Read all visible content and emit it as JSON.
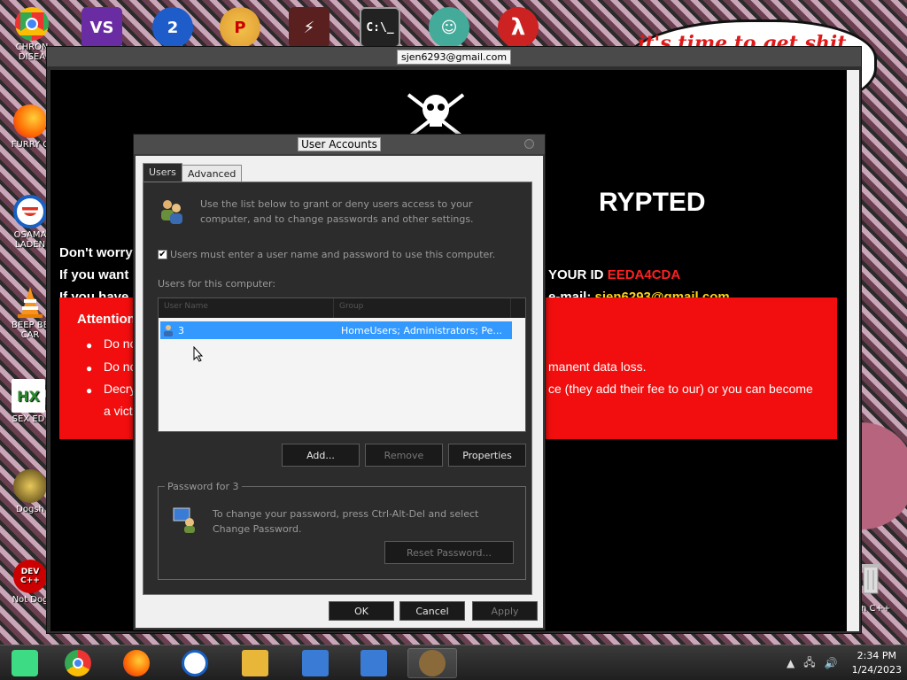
{
  "desktop": {
    "icons": [
      {
        "label": "CHRON DISEA",
        "glyph": "",
        "color": "#e33"
      },
      {
        "label": "FURRY C",
        "glyph": "",
        "color": "#f60"
      },
      {
        "label": "OSAMA LADEN",
        "glyph": "",
        "color": "#1760c4"
      },
      {
        "label": "BEEP BE CAR",
        "glyph": "",
        "color": "#f7931e"
      },
      {
        "label": "SEX ED",
        "glyph": "HX",
        "color": "#4a4"
      },
      {
        "label": "Dogsh",
        "glyph": "",
        "color": "#aa8a2a"
      },
      {
        "label": "Not Dog",
        "glyph": "DEV C++",
        "color": "#c00"
      }
    ],
    "top_icons": [
      {
        "name": "visual-studio-icon",
        "glyph": "VS",
        "color": "#6a2ca3"
      },
      {
        "name": "vcs-2-icon",
        "glyph": "2",
        "color": "#1d5cc9"
      },
      {
        "name": "p-app-icon",
        "glyph": "P",
        "color": "#d93"
      },
      {
        "name": "thunder-game-icon",
        "glyph": "⚡",
        "color": "#b33"
      },
      {
        "name": "cmd-icon",
        "glyph": "C:\\_",
        "color": "#222"
      },
      {
        "name": "santa-icon",
        "glyph": "☺",
        "color": "#4a9"
      },
      {
        "name": "half-life-icon",
        "glyph": "λ",
        "color": "#c22"
      }
    ],
    "right_icon_label": "n C++",
    "bubble_text": "it's time to get shit",
    "bubble_te": "te"
  },
  "ransom": {
    "title": "sjen6293@gmail.com",
    "heading": "RYPTED",
    "line1": "Don't worry",
    "line2_left": "If you want",
    "line2_right_label": "YOUR ID ",
    "line2_right_id": "EEDA4CDA",
    "line3_left": "If you have",
    "line3_right_label": "e-mail: ",
    "line3_right_email": "sjen6293@gmail.com",
    "attention": "Attention",
    "bullets": [
      "Do no",
      "Do no",
      "Decry"
    ],
    "bullet2_right": "manent data loss.",
    "bullet3_right": "ce (they add their fee to our) or you can become",
    "bullet3_cont": "a vict"
  },
  "dialog": {
    "title": "User Accounts",
    "tabs": [
      "Users",
      "Advanced"
    ],
    "intro": "Use the list below to grant or deny users access to your computer, and to change passwords and other settings.",
    "checkbox_label": "Users must enter a user name and password to use this computer.",
    "checkbox_checked": "✔",
    "users_label": "Users for this computer:",
    "columns": [
      "User Name",
      "Group"
    ],
    "rows": [
      {
        "user": "3",
        "group": "HomeUsers; Administrators; Pe..."
      }
    ],
    "buttons": {
      "add": "Add...",
      "remove": "Remove",
      "properties": "Properties"
    },
    "password_group": "Password for 3",
    "password_text": "To change your password, press Ctrl-Alt-Del and select Change Password.",
    "reset_button": "Reset Password...",
    "ok": "OK",
    "cancel": "Cancel",
    "apply": "Apply"
  },
  "taskbar": {
    "items": [
      {
        "name": "android-studio-taskbar",
        "glyph": "",
        "color": "#3ddc84"
      },
      {
        "name": "chrome-taskbar",
        "glyph": "",
        "color": "#e33"
      },
      {
        "name": "firefox-taskbar",
        "glyph": "",
        "color": "#f60"
      },
      {
        "name": "obama-taskbar",
        "glyph": "",
        "color": "#1760c4"
      },
      {
        "name": "file-explorer-taskbar",
        "glyph": "",
        "color": "#e8b73a"
      },
      {
        "name": "network-setup-taskbar",
        "glyph": "",
        "color": "#3a7bd5"
      },
      {
        "name": "network-setup-2-taskbar",
        "glyph": "",
        "color": "#3a7bd5"
      },
      {
        "name": "user-accounts-taskbar",
        "glyph": "",
        "color": "#8a6a3a"
      }
    ],
    "time": "2:34 PM",
    "date": "1/24/2023",
    "tray_arrow": "▲",
    "tray_network": "🖧",
    "tray_volume": "🔊"
  }
}
